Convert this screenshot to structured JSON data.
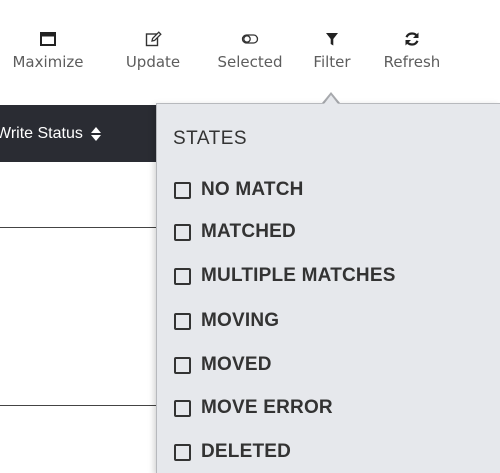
{
  "toolbar": {
    "items": [
      {
        "label": "Maximize",
        "icon": "maximize-icon"
      },
      {
        "label": "Update",
        "icon": "edit-icon"
      },
      {
        "label": "Selected",
        "icon": "toggle-icon"
      },
      {
        "label": "Filter",
        "icon": "filter-icon"
      },
      {
        "label": "Refresh",
        "icon": "refresh-icon"
      }
    ]
  },
  "table": {
    "column_header": "Write Status",
    "sort_icon": "sort-icon"
  },
  "filter_dropdown": {
    "title": "STATES",
    "options": [
      {
        "label": "NO MATCH",
        "checked": false
      },
      {
        "label": "MATCHED",
        "checked": false
      },
      {
        "label": "MULTIPLE MATCHES",
        "checked": false
      },
      {
        "label": "MOVING",
        "checked": false
      },
      {
        "label": "MOVED",
        "checked": false
      },
      {
        "label": "MOVE ERROR",
        "checked": false
      },
      {
        "label": "DELETED",
        "checked": false
      }
    ]
  },
  "colors": {
    "header_bg": "#2a2c33",
    "dropdown_bg": "#e6e8ec",
    "toolbar_text": "#5d5d5d",
    "option_text": "#333333"
  }
}
